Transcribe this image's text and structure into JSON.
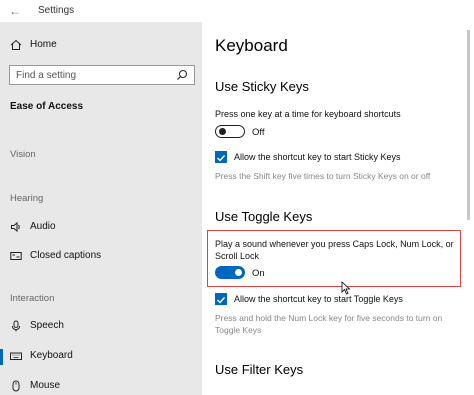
{
  "window": {
    "title": "Settings",
    "back_glyph": "←",
    "minimize_glyph": "—",
    "maximize_glyph": "☐",
    "close_glyph": "✕"
  },
  "sidebar": {
    "home_label": "Home",
    "search_placeholder": "Find a setting",
    "section_title": "Ease of Access",
    "groups": {
      "vision": "Vision",
      "hearing": "Hearing",
      "interaction": "Interaction"
    },
    "items": {
      "audio": "Audio",
      "closed_captions": "Closed captions",
      "speech": "Speech",
      "keyboard": "Keyboard",
      "mouse": "Mouse"
    },
    "selected_item": "keyboard"
  },
  "main": {
    "title": "Keyboard",
    "sticky": {
      "heading": "Use Sticky Keys",
      "desc": "Press one key at a time for keyboard shortcuts",
      "toggle_state": "Off",
      "checkbox_label": "Allow the shortcut key to start Sticky Keys",
      "checkbox_checked": true,
      "hint": "Press the Shift key five times to turn Sticky Keys on or off"
    },
    "toggle_keys": {
      "heading": "Use Toggle Keys",
      "desc_line1": "Play a sound whenever you press Caps Lock, Num Lock, or",
      "desc_line2": "Scroll Lock",
      "toggle_state": "On",
      "checkbox_label": "Allow the shortcut key to start Toggle Keys",
      "checkbox_checked": true,
      "hint_line1": "Press and hold the Num Lock key for five seconds to turn on",
      "hint_line2": "Toggle Keys"
    },
    "filter": {
      "heading": "Use Filter Keys"
    }
  },
  "colors": {
    "accent": "#0067c0",
    "highlight_border": "#e0443e",
    "sidebar_bg": "#e8e8e8"
  },
  "icons": [
    "back-arrow-icon",
    "home-icon",
    "search-icon",
    "speaker-icon",
    "closed-captions-icon",
    "speech-icon",
    "keyboard-icon",
    "mouse-icon",
    "checkmark-icon",
    "mouse-cursor-icon"
  ]
}
